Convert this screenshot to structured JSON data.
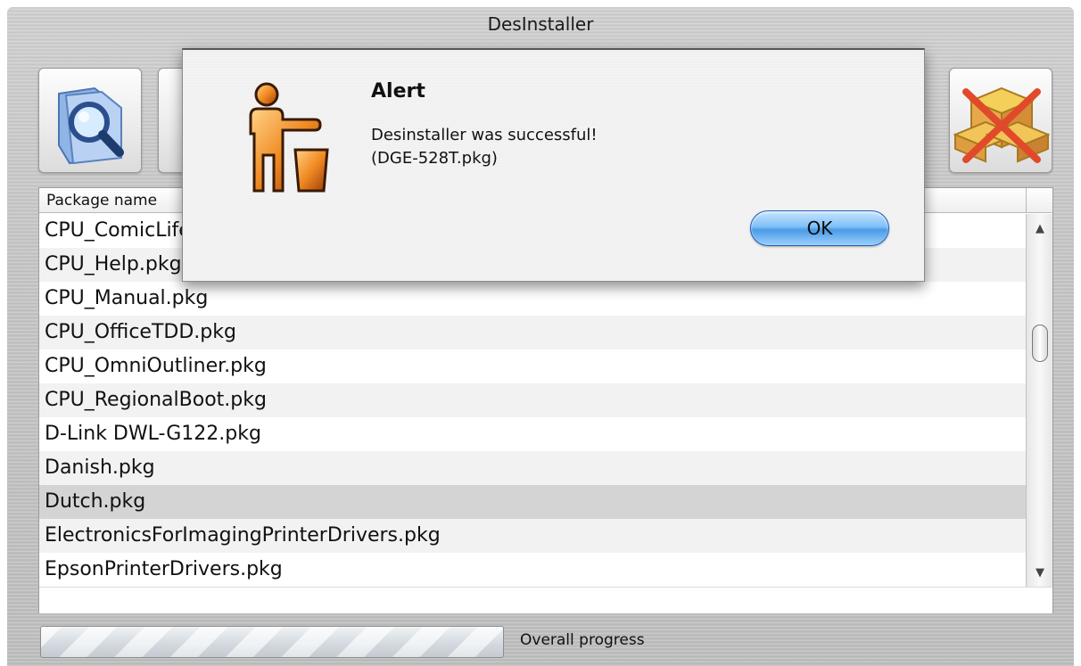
{
  "window": {
    "title": "DesInstaller"
  },
  "toolbar": {
    "search_icon": "magnifier-on-folder-icon",
    "delete_icon": "crossed-out-packages-icon"
  },
  "table": {
    "column_header": "Package name",
    "rows": [
      "CPU_ComicLife.pkg",
      "CPU_Help.pkg",
      "CPU_Manual.pkg",
      "CPU_OfficeTDD.pkg",
      "CPU_OmniOutliner.pkg",
      "CPU_RegionalBoot.pkg",
      "D-Link DWL-G122.pkg",
      "Danish.pkg",
      "Dutch.pkg",
      "ElectronicsForImagingPrinterDrivers.pkg",
      "EpsonPrinterDrivers.pkg"
    ],
    "selected_row": "Dutch.pkg"
  },
  "progress": {
    "label": "Overall progress"
  },
  "alert": {
    "title": "Alert",
    "message_line1": "Desinstaller was successful!",
    "message_line2": "(DGE-528T.pkg)",
    "ok_label": "OK",
    "icon": "trash-person-icon"
  },
  "colors": {
    "ok_button": "#4b9be8",
    "icon_orange": "#e07a1c"
  }
}
